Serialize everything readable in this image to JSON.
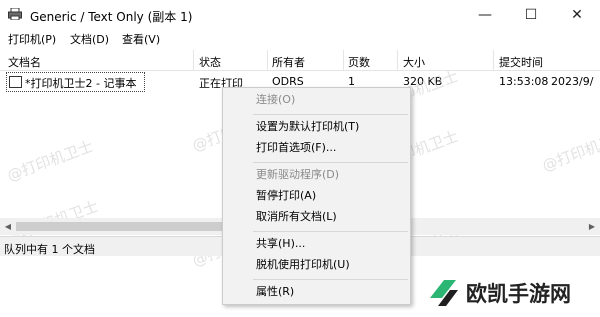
{
  "window": {
    "title": "Generic / Text Only (副本 1)",
    "controls": {
      "minimize": "—",
      "maximize": "☐",
      "close": "✕"
    }
  },
  "menubar": [
    "打印机(P)",
    "文档(D)",
    "查看(V)"
  ],
  "columns": [
    "文档名",
    "状态",
    "所有者",
    "页数",
    "大小",
    "提交时间"
  ],
  "job": {
    "name": "*打印机卫士2 - 记事本",
    "status": "正在打印",
    "owner": "ODRS",
    "pages": "1",
    "size": "320 KB",
    "time": "13:53:08",
    "date": "2023/9/"
  },
  "statusbar": {
    "text": "队列中有 1 个文档"
  },
  "context_menu": [
    {
      "label": "连接(O)",
      "disabled": true
    },
    {
      "label": "设置为默认打印机(T)",
      "disabled": false
    },
    {
      "label": "打印首选项(F)...",
      "disabled": false
    },
    {
      "label": "更新驱动程序(D)",
      "disabled": true
    },
    {
      "label": "暂停打印(A)",
      "disabled": false
    },
    {
      "label": "取消所有文档(L)",
      "disabled": false
    },
    {
      "label": "共享(H)...",
      "disabled": false
    },
    {
      "label": "脱机使用打印机(U)",
      "disabled": false
    },
    {
      "label": "属性(R)",
      "disabled": false
    }
  ],
  "watermark": "@打印机卫士",
  "logo": {
    "text": "欧凯手游网",
    "accent_color": "#2bb673"
  }
}
